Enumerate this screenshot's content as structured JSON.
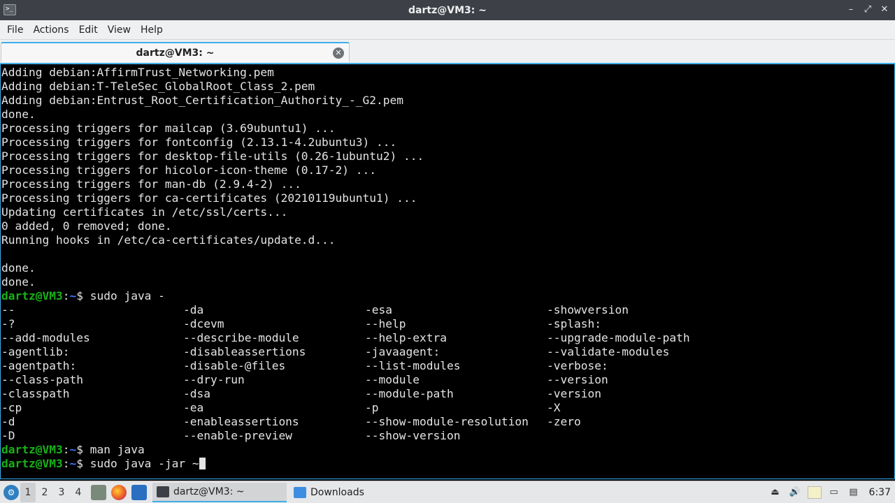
{
  "window": {
    "title": "dartz@VM3: ~",
    "controls": [
      "–",
      "⤢",
      "✕"
    ]
  },
  "menu": [
    "File",
    "Actions",
    "Edit",
    "View",
    "Help"
  ],
  "tab": {
    "title": "dartz@VM3: ~",
    "close": "✕"
  },
  "terminal": {
    "output": [
      "Adding debian:AffirmTrust_Networking.pem",
      "Adding debian:T-TeleSec_GlobalRoot_Class_2.pem",
      "Adding debian:Entrust_Root_Certification_Authority_-_G2.pem",
      "done.",
      "Processing triggers for mailcap (3.69ubuntu1) ...",
      "Processing triggers for fontconfig (2.13.1-4.2ubuntu3) ...",
      "Processing triggers for desktop-file-utils (0.26-1ubuntu2) ...",
      "Processing triggers for hicolor-icon-theme (0.17-2) ...",
      "Processing triggers for man-db (2.9.4-2) ...",
      "Processing triggers for ca-certificates (20210119ubuntu1) ...",
      "Updating certificates in /etc/ssl/certs...",
      "0 added, 0 removed; done.",
      "Running hooks in /etc/ca-certificates/update.d...",
      "",
      "done.",
      "done."
    ],
    "prompt_user": "dartz@VM3",
    "prompt_sep": ":",
    "prompt_path": "~",
    "prompt_end": "$ ",
    "cmd1": "sudo java -",
    "completions": [
      [
        "--",
        "-da",
        "-esa",
        "-showversion"
      ],
      [
        "-?",
        "-dcevm",
        "--help",
        "-splash:"
      ],
      [
        "--add-modules",
        "--describe-module",
        "--help-extra",
        "--upgrade-module-path"
      ],
      [
        "-agentlib:",
        "-disableassertions",
        "-javaagent:",
        "--validate-modules"
      ],
      [
        "-agentpath:",
        "-disable-@files",
        "--list-modules",
        "-verbose:"
      ],
      [
        "--class-path",
        "--dry-run",
        "--module",
        "--version"
      ],
      [
        "-classpath",
        "-dsa",
        "--module-path",
        "-version"
      ],
      [
        "-cp",
        "-ea",
        "-p",
        "-X"
      ],
      [
        "-d",
        "-enableassertions",
        "--show-module-resolution",
        "-zero"
      ],
      [
        "-D",
        "--enable-preview",
        "--show-version",
        ""
      ]
    ],
    "cmd2": "man java",
    "cmd3": "sudo java -jar ~"
  },
  "taskbar": {
    "workspaces": [
      "1",
      "2",
      "3",
      "4"
    ],
    "active_workspace": "1",
    "tasks": [
      {
        "label": "dartz@VM3: ~",
        "icon": "terminal-icon"
      },
      {
        "label": "Downloads",
        "icon": "folder-icon"
      }
    ],
    "clock": "6:37"
  }
}
